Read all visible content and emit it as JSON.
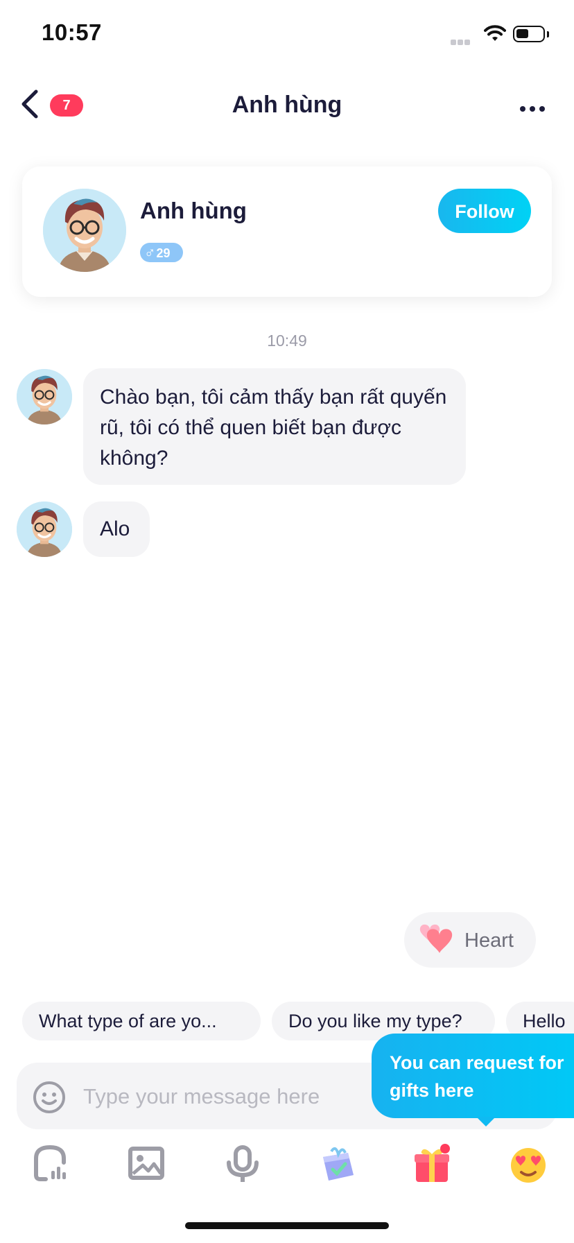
{
  "status_bar": {
    "time": "10:57"
  },
  "nav": {
    "unread_count": "7",
    "title": "Anh hùng"
  },
  "profile": {
    "name": "Anh hùng",
    "gender_symbol": "♂",
    "age": "29",
    "follow_label": "Follow"
  },
  "chat": {
    "time_separator": "10:49",
    "messages": [
      {
        "text": "Chào bạn, tôi cảm thấy bạn rất quyến rũ, tôi có thể quen biết bạn được không?"
      },
      {
        "text": "Alo"
      }
    ]
  },
  "heart_chip": {
    "label": "Heart"
  },
  "quick_replies": [
    "What type of are yo...",
    "Do you like my type?",
    "Hello"
  ],
  "input": {
    "placeholder": "Type your message here"
  },
  "tooltip": {
    "text": "You can request for gifts here"
  },
  "toolbar": [
    "voice-room-icon",
    "image-icon",
    "microphone-icon",
    "gift-box-icon",
    "gift-icon",
    "heart-eyes-emoji-icon"
  ],
  "colors": {
    "accent": "#1fb8f0",
    "badge": "#ff3b5c",
    "text": "#1c1c3a"
  }
}
